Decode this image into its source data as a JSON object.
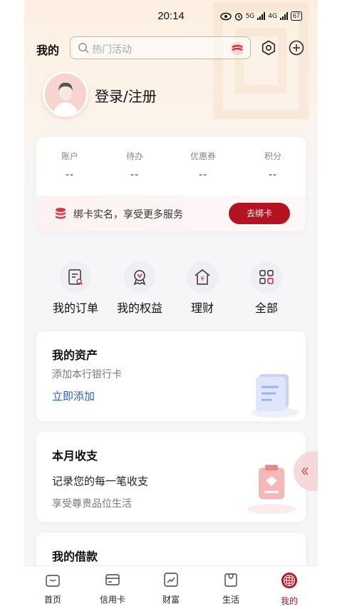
{
  "status_bar": {
    "time": "20:14",
    "battery": "67",
    "net1": "5G",
    "net2": "4G"
  },
  "header": {
    "title": "我的",
    "search_placeholder": "热门活动"
  },
  "profile": {
    "login_label": "登录/注册"
  },
  "account": {
    "stats": [
      {
        "label": "账户",
        "value": "--"
      },
      {
        "label": "待办",
        "value": "--"
      },
      {
        "label": "优惠券",
        "value": "--"
      },
      {
        "label": "积分",
        "value": "--"
      }
    ],
    "bind_text": "绑卡实名，享受更多服务",
    "bind_button": "去绑卡"
  },
  "quick_entries": [
    {
      "label": "我的订单",
      "icon": "order-icon"
    },
    {
      "label": "我的权益",
      "icon": "benefits-icon"
    },
    {
      "label": "理财",
      "icon": "wealth-house-icon"
    },
    {
      "label": "全部",
      "icon": "grid-icon"
    }
  ],
  "assets_card": {
    "title": "我的资产",
    "subtitle": "添加本行银行卡",
    "link": "立即添加"
  },
  "expense_card": {
    "title": "本月收支",
    "line1": "记录您的每一笔收支",
    "line2": "享受尊贵品位生活"
  },
  "loan_card": {
    "title": "我的借款"
  },
  "tabs": [
    {
      "label": "首页",
      "icon": "home-icon"
    },
    {
      "label": "信用卡",
      "icon": "credit-card-icon"
    },
    {
      "label": "财富",
      "icon": "wealth-chart-icon"
    },
    {
      "label": "生活",
      "icon": "shopping-bag-icon"
    },
    {
      "label": "我的",
      "icon": "profile-emblem-icon",
      "active": true
    }
  ],
  "colors": {
    "brand": "#b3141f",
    "link": "#2b5fb0"
  }
}
